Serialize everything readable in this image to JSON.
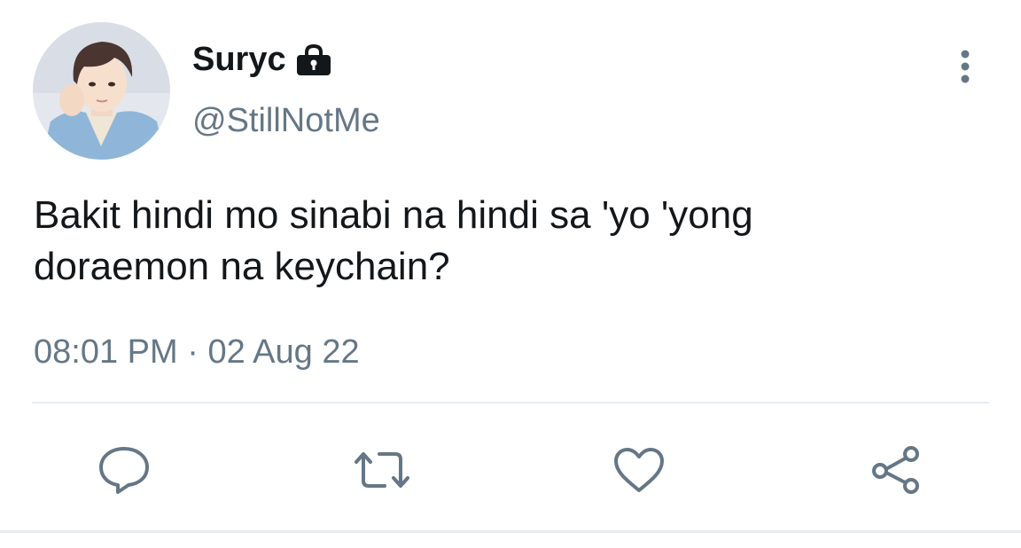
{
  "tweet": {
    "display_name": "Suryc",
    "handle": "@StillNotMe",
    "text_line1": "Bakit hindi mo sinabi na hindi sa 'yo 'yong",
    "text_line2": "doraemon na keychain?",
    "time": "08:01 PM",
    "separator": "·",
    "date": "02 Aug 22",
    "protected": true,
    "avatar_icon": "user-photo",
    "lock_icon": "lock-icon"
  },
  "actions": [
    {
      "name": "reply",
      "icon": "comment-icon"
    },
    {
      "name": "retweet",
      "icon": "retweet-icon"
    },
    {
      "name": "like",
      "icon": "heart-icon"
    },
    {
      "name": "share",
      "icon": "share-icon"
    }
  ],
  "colors": {
    "primary_text": "#14171a",
    "secondary_text": "#657786",
    "divider": "#e6ecf0",
    "icon": "#657786"
  }
}
